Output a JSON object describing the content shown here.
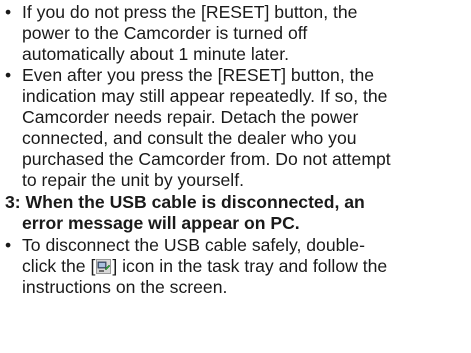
{
  "document": {
    "bullet_char": "•",
    "items": [
      {
        "lines": [
          "If you do not press the [RESET] button, the",
          "power to the Camcorder is turned off",
          "automatically about 1 minute later."
        ]
      },
      {
        "lines": [
          "Even after you press the [RESET] button, the",
          "indication may still appear repeatedly. If so, the",
          "Camcorder needs repair. Detach the power",
          "connected, and consult the dealer who you",
          "purchased the Camcorder from. Do not attempt",
          "to repair the unit by yourself."
        ]
      }
    ],
    "section": {
      "lines": [
        "3: When the USB cable is disconnected, an",
        "error message will appear on PC."
      ]
    },
    "last_item": {
      "line1": "To disconnect the USB cable safely, double-",
      "line2_before": "click the [",
      "line2_after": "] icon in the task tray and follow the",
      "line3": "instructions on the screen.",
      "icon_name": "usb-safely-remove-icon"
    }
  }
}
